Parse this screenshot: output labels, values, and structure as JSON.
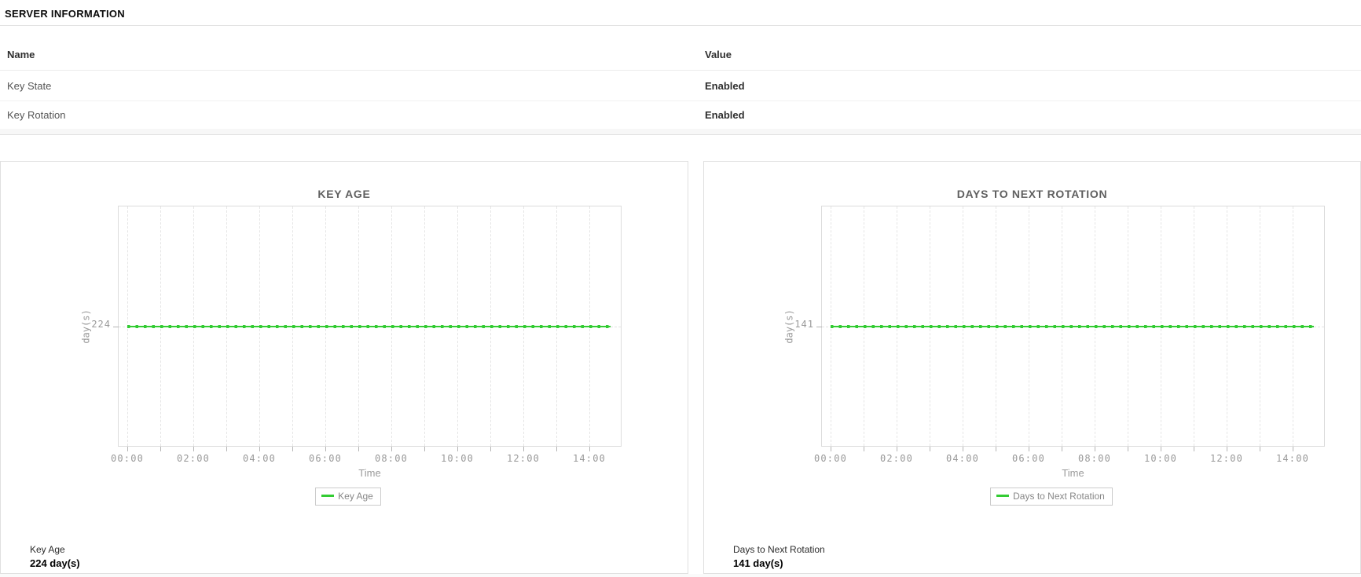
{
  "header": {
    "title": "SERVER INFORMATION"
  },
  "table": {
    "columns": [
      "Name",
      "Value"
    ],
    "rows": [
      {
        "name": "Key State",
        "value": "Enabled"
      },
      {
        "name": "Key Rotation",
        "value": "Enabled"
      }
    ]
  },
  "chart_data": [
    {
      "type": "line",
      "title": "KEY AGE",
      "xlabel": "Time",
      "ylabel": "day(s)",
      "x_ticks": [
        "00:00",
        "02:00",
        "04:00",
        "06:00",
        "08:00",
        "10:00",
        "12:00",
        "14:00"
      ],
      "x_minor_tick_interval_hours": 1,
      "x_range": [
        "00:00",
        "15:15"
      ],
      "y_tick_labels": [
        "224"
      ],
      "series": [
        {
          "name": "Key Age",
          "constant_value": 224,
          "x_start": "00:00",
          "x_end": "14:40",
          "color": "#33cc33",
          "markers": "dots-15min"
        }
      ],
      "legend": {
        "position": "bottom",
        "entries": [
          "Key Age"
        ]
      },
      "grid": true
    },
    {
      "type": "line",
      "title": "DAYS TO NEXT ROTATION",
      "xlabel": "Time",
      "ylabel": "day(s)",
      "x_ticks": [
        "00:00",
        "02:00",
        "04:00",
        "06:00",
        "08:00",
        "10:00",
        "12:00",
        "14:00"
      ],
      "x_minor_tick_interval_hours": 1,
      "x_range": [
        "00:00",
        "15:15"
      ],
      "y_tick_labels": [
        "141"
      ],
      "series": [
        {
          "name": "Days to Next Rotation",
          "constant_value": 141,
          "x_start": "00:00",
          "x_end": "14:40",
          "color": "#33cc33",
          "markers": "dots-15min"
        }
      ],
      "legend": {
        "position": "bottom",
        "entries": [
          "Days to Next Rotation"
        ]
      },
      "grid": true
    }
  ],
  "summaries": [
    {
      "label": "Key Age",
      "value": "224 day(s)"
    },
    {
      "label": "Days to Next Rotation",
      "value": "141 day(s)"
    }
  ],
  "colors": {
    "series_green": "#33cc33",
    "panel_border": "#e0e0e0",
    "grid_line": "#e5e5e5",
    "axis_text": "#999999"
  }
}
